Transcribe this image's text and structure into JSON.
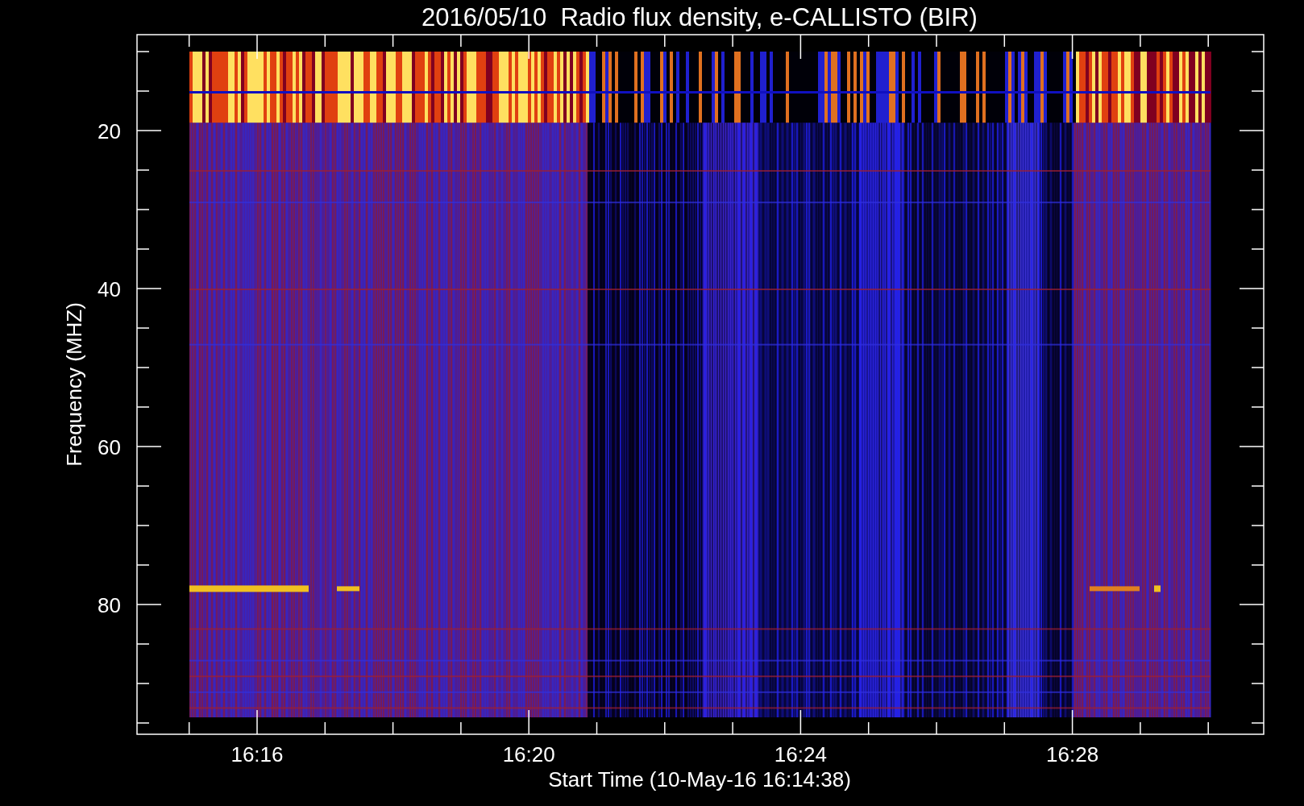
{
  "title": "2016/05/10  Radio flux density, e-CALLISTO (BIR)",
  "ylabel": "Frequency (MHZ)",
  "xlabel": "Start Time (10-May-16 16:14:38)",
  "yticks": [
    "20",
    "40",
    "60",
    "80"
  ],
  "xticks": [
    "16:16",
    "16:20",
    "16:24",
    "16:28"
  ]
}
